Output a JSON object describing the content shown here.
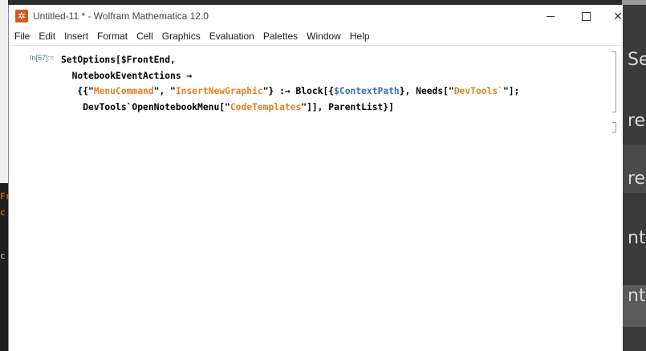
{
  "window": {
    "title": "Untitled-11 * - Wolfram Mathematica 12.0",
    "app_icon_glyph": "✲",
    "minimize_glyph": "",
    "maximize_glyph": "",
    "close_glyph": "✕"
  },
  "menu": [
    "File",
    "Edit",
    "Insert",
    "Format",
    "Cell",
    "Graphics",
    "Evaluation",
    "Palettes",
    "Window",
    "Help"
  ],
  "cell": {
    "label": "In[57]:=",
    "line1": {
      "a": "SetOptions[$FrontEnd,"
    },
    "line2": {
      "a": "NotebookEventActions →"
    },
    "line3": {
      "a": "{{\"",
      "s1": "MenuCommand",
      "b": "\", \"",
      "s2": "InsertNewGraphic",
      "c": "\"} :→ Block[{",
      "sym": "$ContextPath",
      "d": "}, Needs[\"",
      "s3": "DevTools`",
      "e": "\"];"
    },
    "line4": {
      "a": "DevTools`OpenNotebookMenu[\"",
      "s1": "CodeTemplates",
      "b": "\"]], ParentList}]"
    }
  },
  "background": {
    "right_texts": [
      "Se",
      "re",
      "re",
      "nt",
      "nt"
    ],
    "left_texts": [
      "Fr",
      "c",
      "c"
    ]
  },
  "colors": {
    "string": "#e08024",
    "symbol": "#3b6fb6",
    "label": "#4a6e9a",
    "app_icon": "#d65a1f"
  }
}
